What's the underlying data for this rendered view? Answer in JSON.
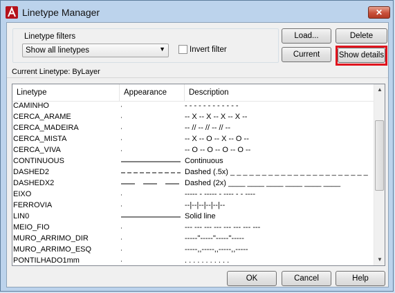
{
  "window": {
    "title": "Linetype Manager",
    "close_label": "✕"
  },
  "filters": {
    "group_label": "Linetype filters",
    "selected": "Show all linetypes",
    "invert_label": "Invert filter",
    "invert_checked": false
  },
  "buttons": {
    "load": "Load...",
    "delete": "Delete",
    "current": "Current",
    "show_details": "Show details",
    "ok": "OK",
    "cancel": "Cancel",
    "help": "Help"
  },
  "current_linetype": "Current Linetype:  ByLayer",
  "list": {
    "columns": [
      "Linetype",
      "Appearance",
      "Description"
    ],
    "rows": [
      {
        "name": "CAMINHO",
        "appearance": "dot",
        "description": "- - - - - - - - - - - -"
      },
      {
        "name": "CERCA_ARAME",
        "appearance": "dot",
        "description": "-- X -- X -- X -- X --"
      },
      {
        "name": "CERCA_MADEIRA",
        "appearance": "dot",
        "description": "-- // -- // -- // --"
      },
      {
        "name": "CERCA_MISTA",
        "appearance": "dot",
        "description": "-- X -- O -- X -- O --"
      },
      {
        "name": "CERCA_VIVA",
        "appearance": "dot",
        "description": "-- O -- O -- O -- O --"
      },
      {
        "name": "CONTINUOUS",
        "appearance": "solid",
        "description": "Continuous"
      },
      {
        "name": "DASHED2",
        "appearance": "dashed-small",
        "description": "Dashed (.5x) _ _ _ _ _ _ _ _ _ _ _ _ _ _ _ _ _ _ _ _ _ _"
      },
      {
        "name": "DASHEDX2",
        "appearance": "dashed-large",
        "description": "Dashed (2x) ____  ____  ____  ____  ____  ____"
      },
      {
        "name": "EIXO",
        "appearance": "dot",
        "description": "----- - ----- - ---- - - ----"
      },
      {
        "name": "FERROVIA",
        "appearance": "dot",
        "description": "--|--|--|--|--|--"
      },
      {
        "name": "LIN0",
        "appearance": "solid",
        "description": "Solid line"
      },
      {
        "name": "MEIO_FIO",
        "appearance": "dot",
        "description": "--- --- --- --- --- --- --- ---"
      },
      {
        "name": "MURO_ARRIMO_DIR",
        "appearance": "dot",
        "description": "-----''-----''-----''-----"
      },
      {
        "name": "MURO_ARRIMO_ESQ",
        "appearance": "dot",
        "description": "-----,,-----,,-----,,-----"
      },
      {
        "name": "PONTILHADO1mm",
        "appearance": "dot",
        "description": ". . . . . . . . . . ."
      }
    ]
  },
  "icons": {
    "app": "autocad-logo-icon",
    "dropdown": "chevron-down-icon",
    "scroll_up": "arrow-up-icon",
    "scroll_down": "arrow-down-icon"
  },
  "colors": {
    "highlight": "#e0141e",
    "window_frame": "#bcd3ec",
    "close_button": "#c9503a"
  }
}
